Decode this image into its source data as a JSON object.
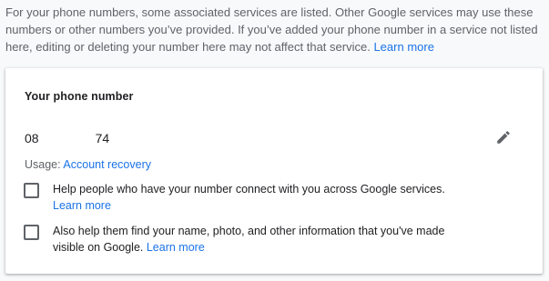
{
  "intro": {
    "text": "For your phone numbers, some associated services are listed. Other Google services may use these numbers or other numbers you’ve provided. If you’ve added your phone number in a service not listed here, editing or deleting your number here may not affect that service.",
    "learn_more": "Learn more"
  },
  "card": {
    "title": "Your phone number",
    "phone": {
      "prefix": "08",
      "suffix": "74"
    },
    "edit_icon": "pencil-icon",
    "usage": {
      "label": "Usage:",
      "value": "Account recovery"
    },
    "options": [
      {
        "text": "Help people who have your number connect with you across Google services.",
        "learn_more": "Learn more",
        "checked": false
      },
      {
        "text": "Also help them find your name, photo, and other information that you've made visible on Google.",
        "learn_more": "Learn more",
        "checked": false
      }
    ]
  },
  "colors": {
    "link": "#1a73e8",
    "secondary_text": "#5f6368",
    "primary_text": "#202124",
    "background": "#f8f9fa"
  }
}
